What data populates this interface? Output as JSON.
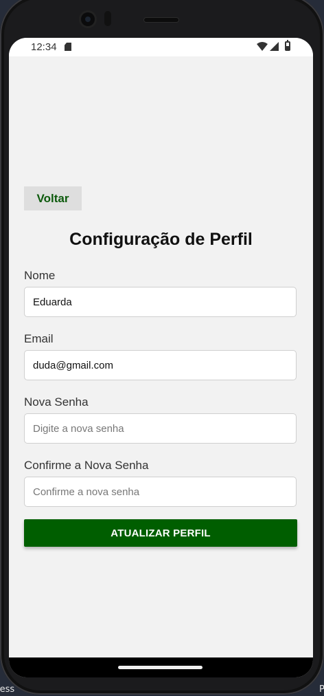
{
  "status_bar": {
    "time": "12:34",
    "icons": [
      "sd-card-icon",
      "wifi-icon",
      "signal-icon",
      "battery-icon"
    ]
  },
  "back_button": {
    "label": "Voltar"
  },
  "page_title": "Configuração de Perfil",
  "form": {
    "name": {
      "label": "Nome",
      "value": "Eduarda",
      "placeholder": ""
    },
    "email": {
      "label": "Email",
      "value": "duda@gmail.com",
      "placeholder": ""
    },
    "new_password": {
      "label": "Nova Senha",
      "value": "",
      "placeholder": "Digite a nova senha"
    },
    "confirm_password": {
      "label": "Confirme a Nova Senha",
      "value": "",
      "placeholder": "Confirme a nova senha"
    }
  },
  "submit_button": {
    "label": "ATUALIZAR PERFIL"
  },
  "desktop": {
    "left_text": "less",
    "right_text": "Pr"
  },
  "colors": {
    "accent": "#005e00",
    "back_text": "#0c5a0c",
    "screen_bg": "#f2f2f2"
  }
}
